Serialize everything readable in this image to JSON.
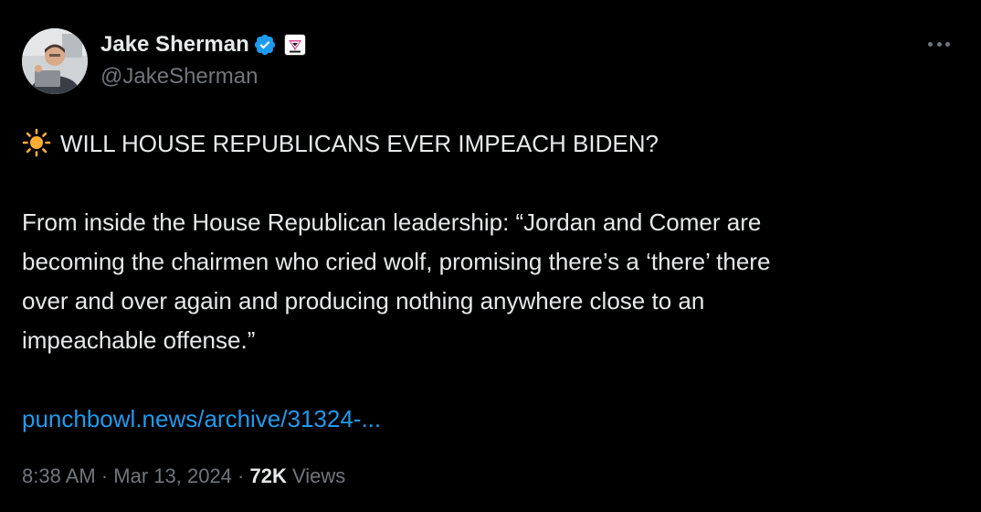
{
  "author": {
    "display_name": "Jake Sherman",
    "handle": "@JakeSherman",
    "verified": true,
    "verified_color": "#1d9bf0"
  },
  "tweet": {
    "headline_emoji": "sun-icon",
    "headline": "WILL HOUSE REPUBLICANS EVER IMPEACH BIDEN?",
    "body_lines": [
      "From inside the House Republican leadership: “Jordan and Comer are",
      "becoming the chairmen who cried wolf, promising there’s a ‘there’ there",
      "over and over again and producing nothing anywhere close to an",
      "impeachable offense.”"
    ],
    "link_text": "punchbowl.news/archive/31324-...",
    "link_color": "#1d9bf0"
  },
  "meta": {
    "time": "8:38 AM",
    "separator1": " · ",
    "date": "Mar 13, 2024",
    "separator2": " · ",
    "views_count": "72K",
    "views_label": " Views"
  },
  "colors": {
    "background": "#000000",
    "text": "#e7e9ea",
    "secondary_text": "#71767b"
  }
}
